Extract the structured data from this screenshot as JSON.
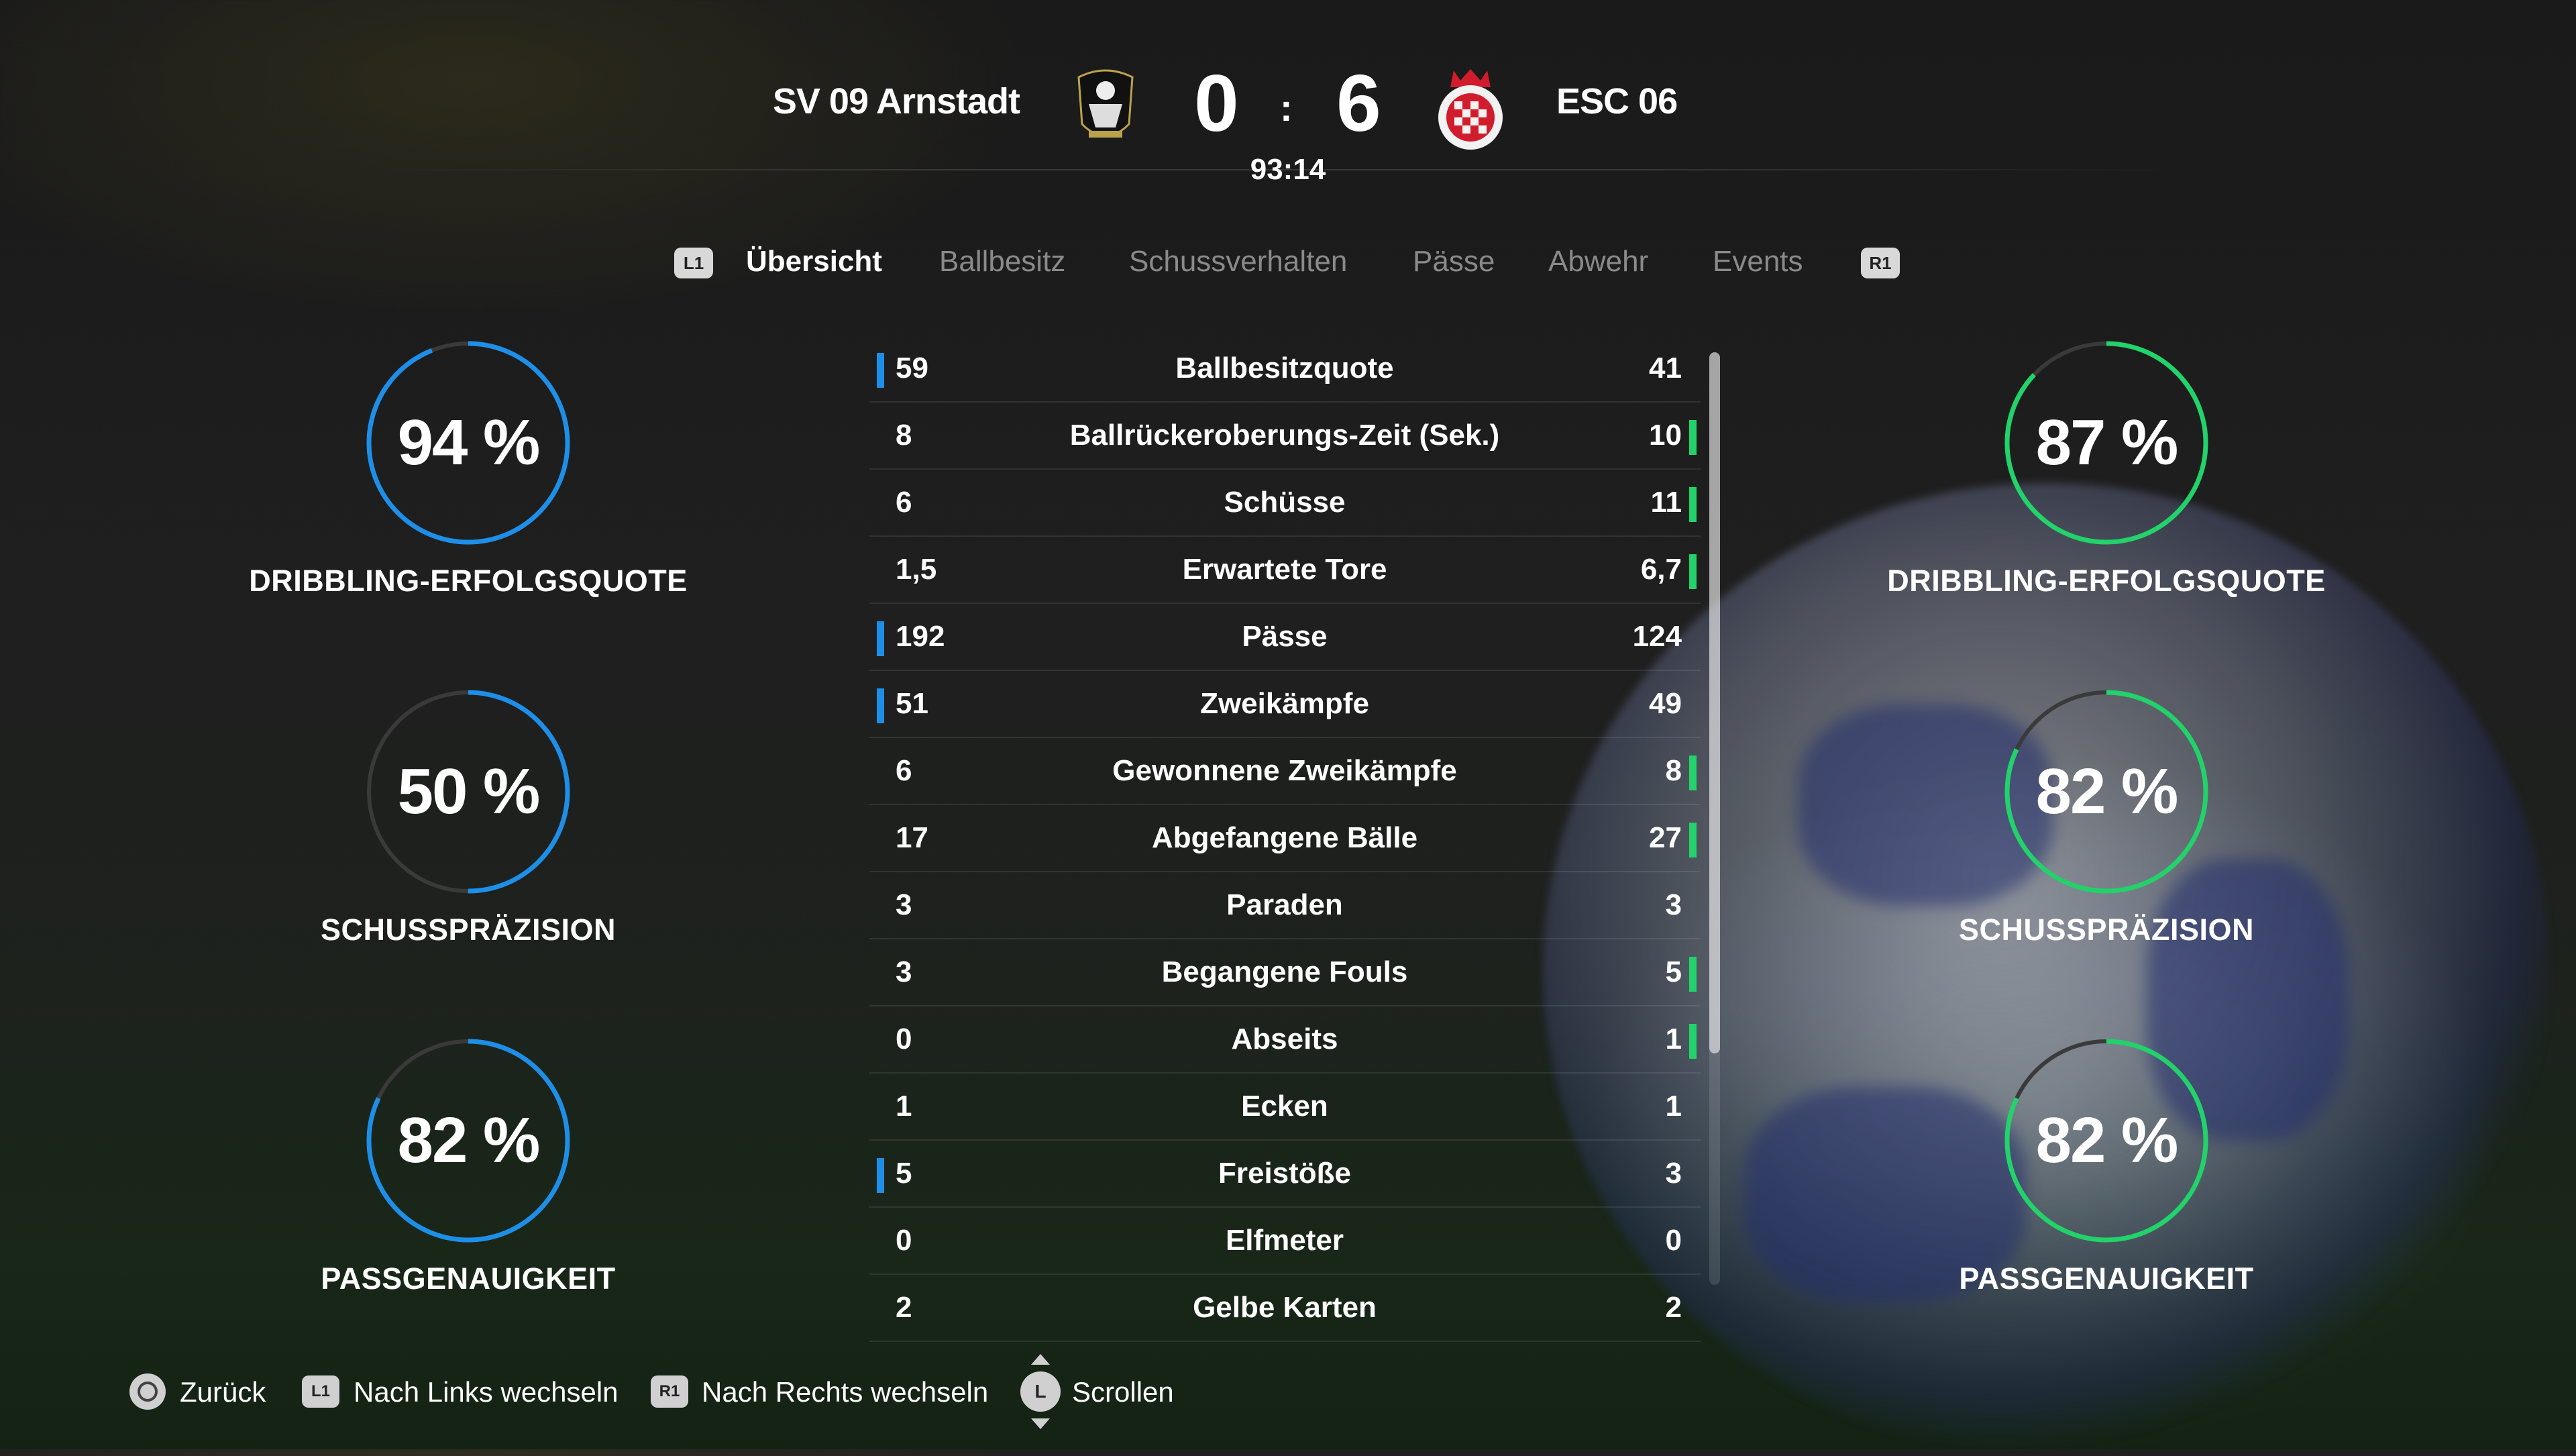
{
  "match": {
    "home_team": "SV 09 Arnstadt",
    "away_team": "ESC 06",
    "home_score": "0",
    "away_score": "6",
    "separator": ":",
    "clock": "93:14"
  },
  "tabs": {
    "left_button": "L1",
    "right_button": "R1",
    "items": [
      "Übersicht",
      "Ballbesitz",
      "Schussverhalten",
      "Pässe",
      "Abwehr",
      "Events"
    ],
    "active": "Übersicht"
  },
  "home_rings": [
    {
      "value": "94 %",
      "fraction": 0.94,
      "label": "DRIBBLING-ERFOLGSQUOTE"
    },
    {
      "value": "50 %",
      "fraction": 0.5,
      "label": "SCHUSSPRÄZISION"
    },
    {
      "value": "82 %",
      "fraction": 0.82,
      "label": "PASSGENAUIGKEIT"
    }
  ],
  "away_rings": [
    {
      "value": "87 %",
      "fraction": 0.87,
      "label": "DRIBBLING-ERFOLGSQUOTE"
    },
    {
      "value": "82 %",
      "fraction": 0.82,
      "label": "SCHUSSPRÄZISION"
    },
    {
      "value": "82 %",
      "fraction": 0.82,
      "label": "PASSGENAUIGKEIT"
    }
  ],
  "stats": [
    {
      "name": "Ballbesitzquote",
      "home": "59",
      "away": "41",
      "leader": "home"
    },
    {
      "name": "Ballrückeroberungs-Zeit (Sek.)",
      "home": "8",
      "away": "10",
      "leader": "away"
    },
    {
      "name": "Schüsse",
      "home": "6",
      "away": "11",
      "leader": "away"
    },
    {
      "name": "Erwartete Tore",
      "home": "1,5",
      "away": "6,7",
      "leader": "away"
    },
    {
      "name": "Pässe",
      "home": "192",
      "away": "124",
      "leader": "home"
    },
    {
      "name": "Zweikämpfe",
      "home": "51",
      "away": "49",
      "leader": "home"
    },
    {
      "name": "Gewonnene Zweikämpfe",
      "home": "6",
      "away": "8",
      "leader": "away"
    },
    {
      "name": "Abgefangene Bälle",
      "home": "17",
      "away": "27",
      "leader": "away"
    },
    {
      "name": "Paraden",
      "home": "3",
      "away": "3",
      "leader": "none"
    },
    {
      "name": "Begangene Fouls",
      "home": "3",
      "away": "5",
      "leader": "away"
    },
    {
      "name": "Abseits",
      "home": "0",
      "away": "1",
      "leader": "away"
    },
    {
      "name": "Ecken",
      "home": "1",
      "away": "1",
      "leader": "none"
    },
    {
      "name": "Freistöße",
      "home": "5",
      "away": "3",
      "leader": "home"
    },
    {
      "name": "Elfmeter",
      "home": "0",
      "away": "0",
      "leader": "none"
    },
    {
      "name": "Gelbe Karten",
      "home": "2",
      "away": "2",
      "leader": "none"
    }
  ],
  "footer": {
    "back": "Zurück",
    "left_switch_button": "L1",
    "left_switch": "Nach Links wechseln",
    "right_switch_button": "R1",
    "right_switch": "Nach Rechts wechseln",
    "scroll_button": "L",
    "scroll": "Scrollen"
  },
  "colors": {
    "home_accent": "#1e8fe8",
    "away_accent": "#22d26a",
    "ring_track": "#3a3a3a"
  }
}
